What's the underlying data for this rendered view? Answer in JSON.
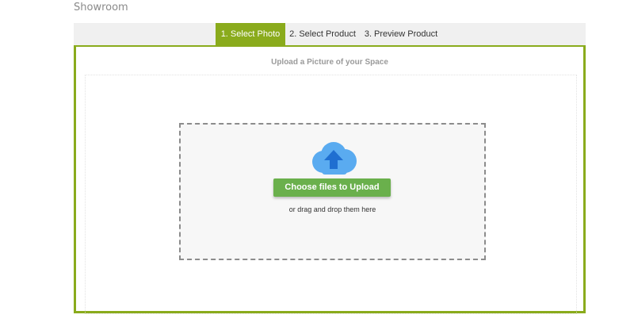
{
  "page": {
    "title": "Showroom"
  },
  "steps": [
    {
      "label": "1. Select Photo",
      "active": true
    },
    {
      "label": "2. Select Product",
      "active": false
    },
    {
      "label": "3. Preview Product",
      "active": false
    }
  ],
  "upload": {
    "heading": "Upload a Picture of your Space",
    "button_label": "Choose files to Upload",
    "hint": "or drag and drop them here",
    "icon": "cloud-upload-icon"
  },
  "colors": {
    "accent": "#8aab1c",
    "button": "#6ab04c",
    "cloud": "#5aabf0",
    "arrow": "#1f6fd1"
  }
}
